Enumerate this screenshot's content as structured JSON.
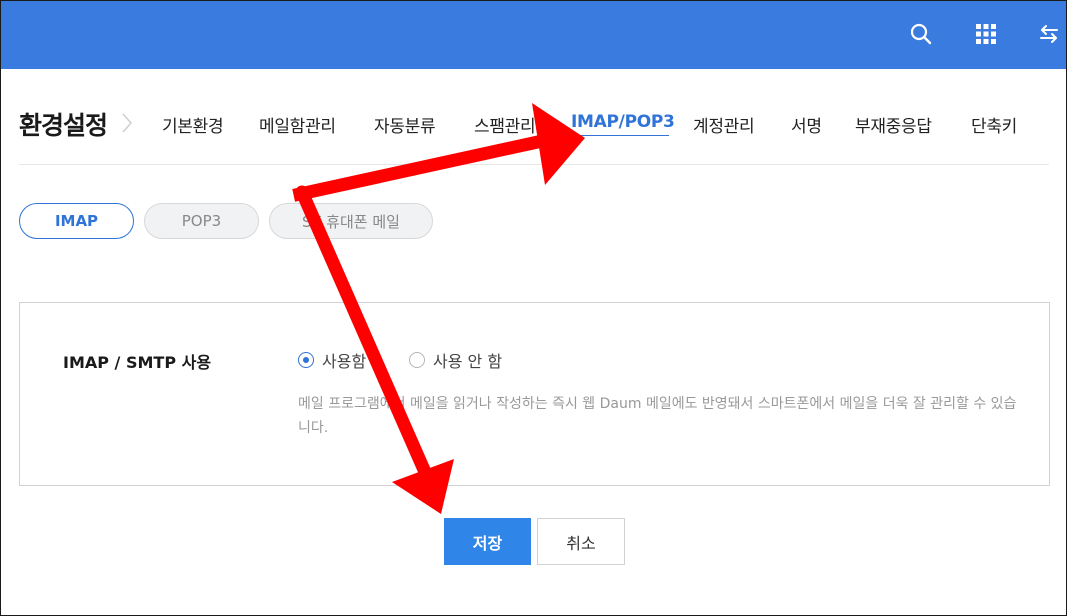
{
  "colors": {
    "topbar": "#3a7be0",
    "accent": "#2f74d6",
    "primary_button": "#2f86e8",
    "annotation_arrow": "#ff0000"
  },
  "header": {
    "icons": [
      "search-icon",
      "apps-grid-icon",
      "switch-icon"
    ]
  },
  "page": {
    "title": "환경설정"
  },
  "nav": {
    "items": [
      {
        "label": "기본환경"
      },
      {
        "label": "메일함관리"
      },
      {
        "label": "자동분류"
      },
      {
        "label": "스팸관리"
      },
      {
        "label": "IMAP/POP3",
        "active": true
      },
      {
        "label": "계정관리"
      },
      {
        "label": "서명"
      },
      {
        "label": "부재중응답"
      },
      {
        "label": "단축키"
      }
    ]
  },
  "subtabs": {
    "items": [
      {
        "label": "IMAP",
        "active": true
      },
      {
        "label": "POP3"
      },
      {
        "label": "SK 휴대폰 메일"
      }
    ]
  },
  "setting": {
    "label": "IMAP / SMTP 사용",
    "options": [
      {
        "label": "사용함",
        "checked": true
      },
      {
        "label": "사용 안 함",
        "checked": false
      }
    ],
    "help": "메일 프로그램에서 메일을 읽거나 작성하는 즉시 웹 Daum 메일에도 반영돼서 스마트폰에서 메일을 더욱 잘 관리할 수 있습니다."
  },
  "buttons": {
    "save": "저장",
    "cancel": "취소"
  }
}
